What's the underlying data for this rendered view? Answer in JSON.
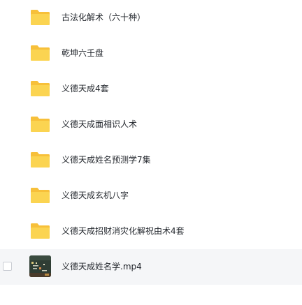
{
  "colors": {
    "folder_back": "#f7c03a",
    "folder_front": "#fbd451",
    "text": "#1f2329",
    "hover_row": "#f5f6f8"
  },
  "files": [
    {
      "name": "古法化解术（六十种）",
      "type": "folder",
      "icon": "folder-icon"
    },
    {
      "name": "乾坤六壬盘",
      "type": "folder",
      "icon": "folder-icon"
    },
    {
      "name": "义德天成4套",
      "type": "folder",
      "icon": "folder-icon"
    },
    {
      "name": "义德天成面相识人术",
      "type": "folder",
      "icon": "folder-icon"
    },
    {
      "name": "义德天成姓名预测学7集",
      "type": "folder",
      "icon": "folder-icon"
    },
    {
      "name": "义德天成玄机八字",
      "type": "folder",
      "icon": "folder-icon"
    },
    {
      "name": "义德天成招财消灾化解祝由术4套",
      "type": "folder",
      "icon": "folder-icon"
    },
    {
      "name": "义德天成姓名学.mp4",
      "type": "video",
      "icon": "video-thumbnail-icon",
      "hovered": true
    }
  ]
}
